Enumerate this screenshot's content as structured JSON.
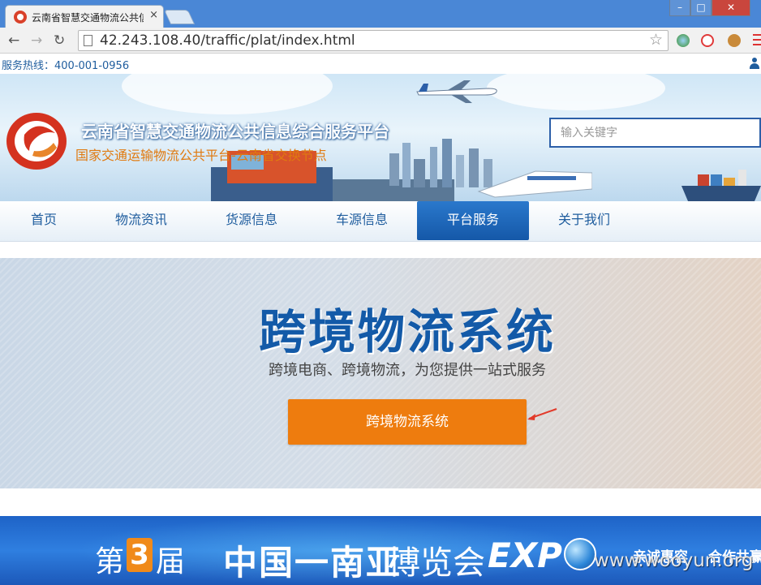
{
  "browser": {
    "tab_title": "云南省智慧交通物流公共信",
    "tab_close": "×",
    "url": "42.243.108.40/traffic/plat/index.html",
    "win_min": "–",
    "win_max": "□",
    "win_close": "✕"
  },
  "topbar": {
    "hotline": "服务热线：400-001-0956"
  },
  "header": {
    "title": "云南省智慧交通物流公共信息综合服务平台",
    "subtitle": "国家交通运输物流公共平台-云南省交换节点",
    "search_placeholder": "输入关键字"
  },
  "nav": {
    "items": [
      {
        "label": "首页"
      },
      {
        "label": "物流资讯"
      },
      {
        "label": "货源信息"
      },
      {
        "label": "车源信息"
      },
      {
        "label": "平台服务"
      },
      {
        "label": "关于我们"
      }
    ],
    "active": "平台服务"
  },
  "hero": {
    "title": "跨境物流系统",
    "subtitle": "跨境电商、跨境物流，为您提供一站式服务",
    "button": "跨境物流系统"
  },
  "expo": {
    "prefix": "第",
    "number": "3",
    "suffix": "届",
    "main": "中国一南亚",
    "light": "博览会",
    "en": "EXP",
    "slogan1": "亲诚惠容",
    "slogan2": "合作共赢"
  },
  "watermark": "www.wooyun.org",
  "colors": {
    "brand_blue": "#1f5d9e",
    "nav_active": "#1f6dbf",
    "button_orange": "#ee7c0e",
    "hero_title": "#135aa8"
  }
}
